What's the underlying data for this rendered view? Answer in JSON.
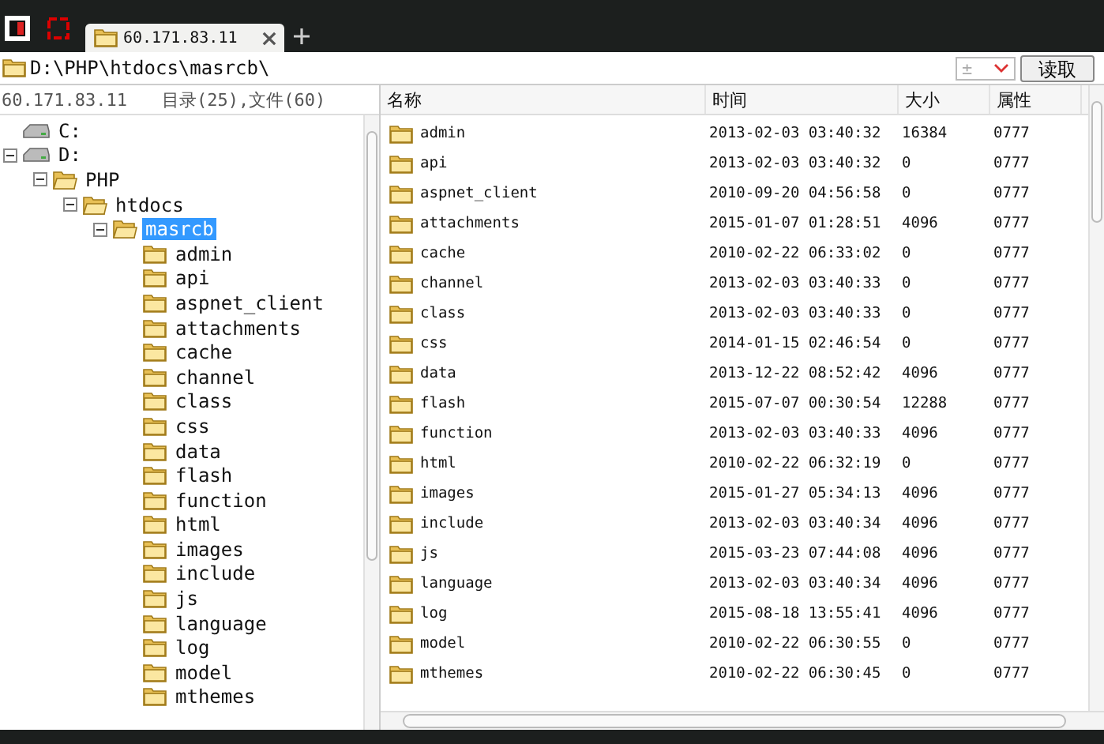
{
  "tabs": [
    {
      "label": "60.171.83.11",
      "selected": true
    }
  ],
  "path_bar": {
    "path": "D:\\PHP\\htdocs\\masrcb\\",
    "combo_value": "±",
    "read_button": "读取"
  },
  "tree_info": {
    "host": "60.171.83.11",
    "counts": "目录(25),文件(60)"
  },
  "tree": [
    {
      "label": "C:",
      "kind": "drive",
      "selected": false
    },
    {
      "label": "D:",
      "kind": "drive",
      "selected": false,
      "expanded": true,
      "children": [
        {
          "label": "PHP",
          "kind": "folder",
          "selected": false,
          "expanded": true,
          "children": [
            {
              "label": "htdocs",
              "kind": "folder",
              "selected": false,
              "expanded": true,
              "children": [
                {
                  "label": "masrcb",
                  "kind": "folder",
                  "selected": true,
                  "expanded": true,
                  "children": [
                    {
                      "label": "admin",
                      "kind": "folder",
                      "selected": false
                    },
                    {
                      "label": "api",
                      "kind": "folder",
                      "selected": false
                    },
                    {
                      "label": "aspnet_client",
                      "kind": "folder",
                      "selected": false
                    },
                    {
                      "label": "attachments",
                      "kind": "folder",
                      "selected": false
                    },
                    {
                      "label": "cache",
                      "kind": "folder",
                      "selected": false
                    },
                    {
                      "label": "channel",
                      "kind": "folder",
                      "selected": false
                    },
                    {
                      "label": "class",
                      "kind": "folder",
                      "selected": false
                    },
                    {
                      "label": "css",
                      "kind": "folder",
                      "selected": false
                    },
                    {
                      "label": "data",
                      "kind": "folder",
                      "selected": false
                    },
                    {
                      "label": "flash",
                      "kind": "folder",
                      "selected": false
                    },
                    {
                      "label": "function",
                      "kind": "folder",
                      "selected": false
                    },
                    {
                      "label": "html",
                      "kind": "folder",
                      "selected": false
                    },
                    {
                      "label": "images",
                      "kind": "folder",
                      "selected": false
                    },
                    {
                      "label": "include",
                      "kind": "folder",
                      "selected": false
                    },
                    {
                      "label": "js",
                      "kind": "folder",
                      "selected": false
                    },
                    {
                      "label": "language",
                      "kind": "folder",
                      "selected": false
                    },
                    {
                      "label": "log",
                      "kind": "folder",
                      "selected": false
                    },
                    {
                      "label": "model",
                      "kind": "folder",
                      "selected": false
                    },
                    {
                      "label": "mthemes",
                      "kind": "folder",
                      "selected": false
                    }
                  ]
                }
              ]
            }
          ]
        }
      ]
    }
  ],
  "table": {
    "columns": [
      "名称",
      "时间",
      "大小",
      "属性"
    ],
    "rows": [
      [
        "admin",
        "2013-02-03 03:40:32",
        "16384",
        "0777"
      ],
      [
        "api",
        "2013-02-03 03:40:32",
        "0",
        "0777"
      ],
      [
        "aspnet_client",
        "2010-09-20 04:56:58",
        "0",
        "0777"
      ],
      [
        "attachments",
        "2015-01-07 01:28:51",
        "4096",
        "0777"
      ],
      [
        "cache",
        "2010-02-22 06:33:02",
        "0",
        "0777"
      ],
      [
        "channel",
        "2013-02-03 03:40:33",
        "0",
        "0777"
      ],
      [
        "class",
        "2013-02-03 03:40:33",
        "0",
        "0777"
      ],
      [
        "css",
        "2014-01-15 02:46:54",
        "0",
        "0777"
      ],
      [
        "data",
        "2013-12-22 08:52:42",
        "4096",
        "0777"
      ],
      [
        "flash",
        "2015-07-07 00:30:54",
        "12288",
        "0777"
      ],
      [
        "function",
        "2013-02-03 03:40:33",
        "4096",
        "0777"
      ],
      [
        "html",
        "2010-02-22 06:32:19",
        "0",
        "0777"
      ],
      [
        "images",
        "2015-01-27 05:34:13",
        "4096",
        "0777"
      ],
      [
        "include",
        "2013-02-03 03:40:34",
        "4096",
        "0777"
      ],
      [
        "js",
        "2015-03-23 07:44:08",
        "4096",
        "0777"
      ],
      [
        "language",
        "2013-02-03 03:40:34",
        "4096",
        "0777"
      ],
      [
        "log",
        "2015-08-18 13:55:41",
        "4096",
        "0777"
      ],
      [
        "model",
        "2010-02-22 06:30:55",
        "0",
        "0777"
      ],
      [
        "mthemes",
        "2010-02-22 06:30:45",
        "0",
        "0777"
      ]
    ]
  }
}
